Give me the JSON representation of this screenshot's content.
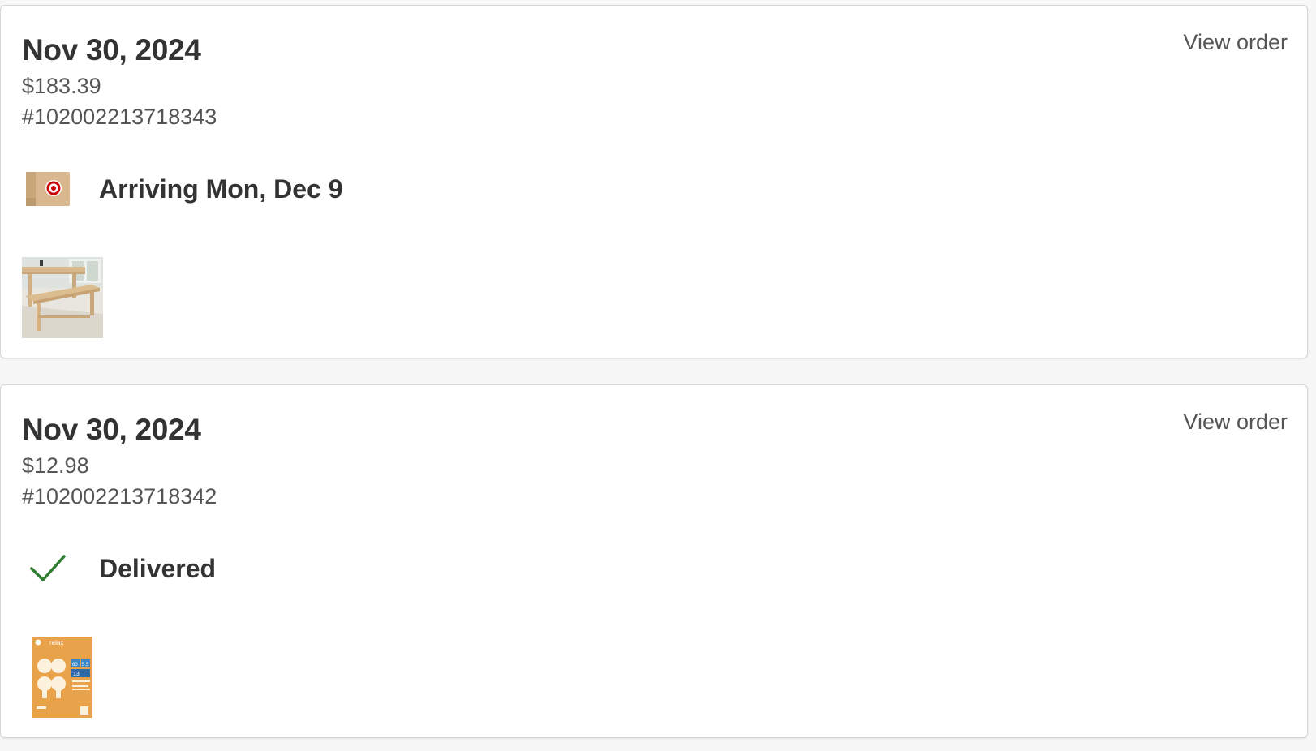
{
  "orders": [
    {
      "date": "Nov 30, 2024",
      "total": "$183.39",
      "number": "#102002213718343",
      "view_label": "View order",
      "status": "Arriving Mon, Dec 9",
      "status_icon": "shipping-box-icon",
      "item_image": "wooden-dining-bench-image"
    },
    {
      "date": "Nov 30, 2024",
      "total": "$12.98",
      "number": "#102002213718342",
      "view_label": "View order",
      "status": "Delivered",
      "status_icon": "checkmark-icon",
      "item_image": "light-bulb-pack-image",
      "product_box": {
        "brand": "relax",
        "numbers": [
          "60",
          "5.5",
          "13"
        ]
      }
    }
  ],
  "colors": {
    "target_red": "#cc0000",
    "delivered_green": "#2e7d32",
    "box_brown": "#d9b88f",
    "bulb_orange": "#e8a34a"
  }
}
